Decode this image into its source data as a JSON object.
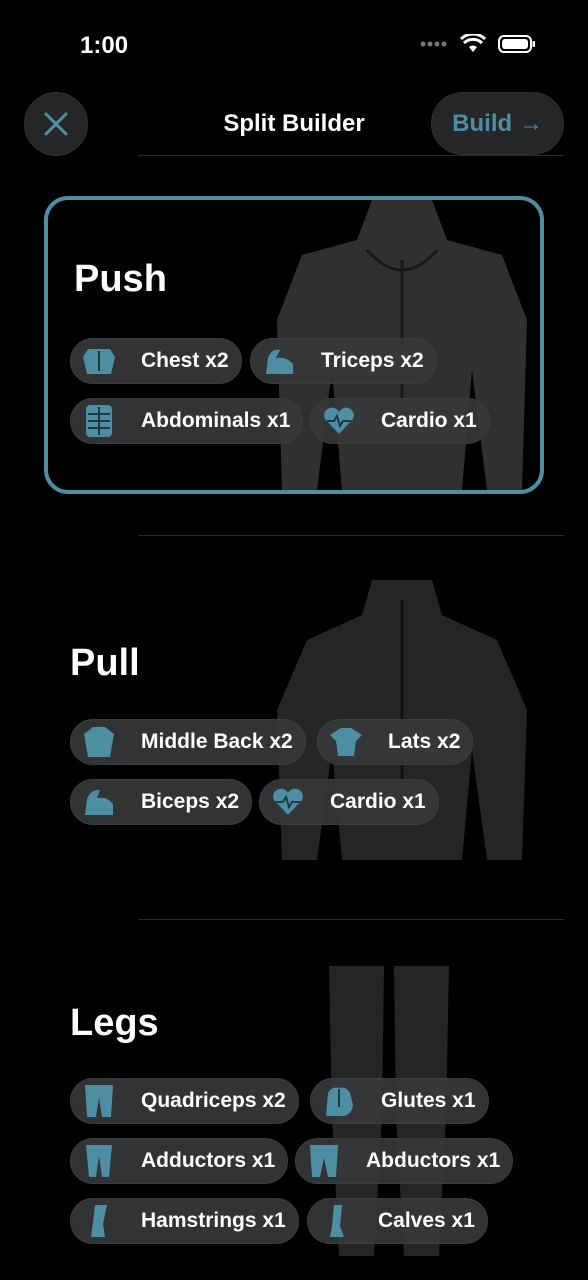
{
  "status": {
    "time": "1:00"
  },
  "nav": {
    "title": "Split Builder",
    "build_label": "Build →"
  },
  "sections": [
    {
      "title": "Push",
      "chips": [
        "Chest x2",
        "Triceps x2",
        "Abdominals x1",
        "Cardio x1"
      ]
    },
    {
      "title": "Pull",
      "chips": [
        "Middle Back x2",
        "Lats x2",
        "Biceps x2",
        "Cardio x1"
      ]
    },
    {
      "title": "Legs",
      "chips": [
        "Quadriceps x2",
        "Glutes x1",
        "Adductors x1",
        "Abductors x1",
        "Hamstrings x1",
        "Calves x1"
      ]
    }
  ],
  "colors": {
    "accent": "#4d8ea3",
    "chip_bg": "#37393b",
    "background": "#000000"
  },
  "icons": [
    "chest-icon",
    "triceps-icon",
    "abdominals-icon",
    "cardio-icon",
    "middle-back-icon",
    "lats-icon",
    "biceps-icon",
    "quadriceps-icon",
    "glutes-icon",
    "adductors-icon",
    "abductors-icon",
    "hamstrings-icon",
    "calves-icon"
  ]
}
